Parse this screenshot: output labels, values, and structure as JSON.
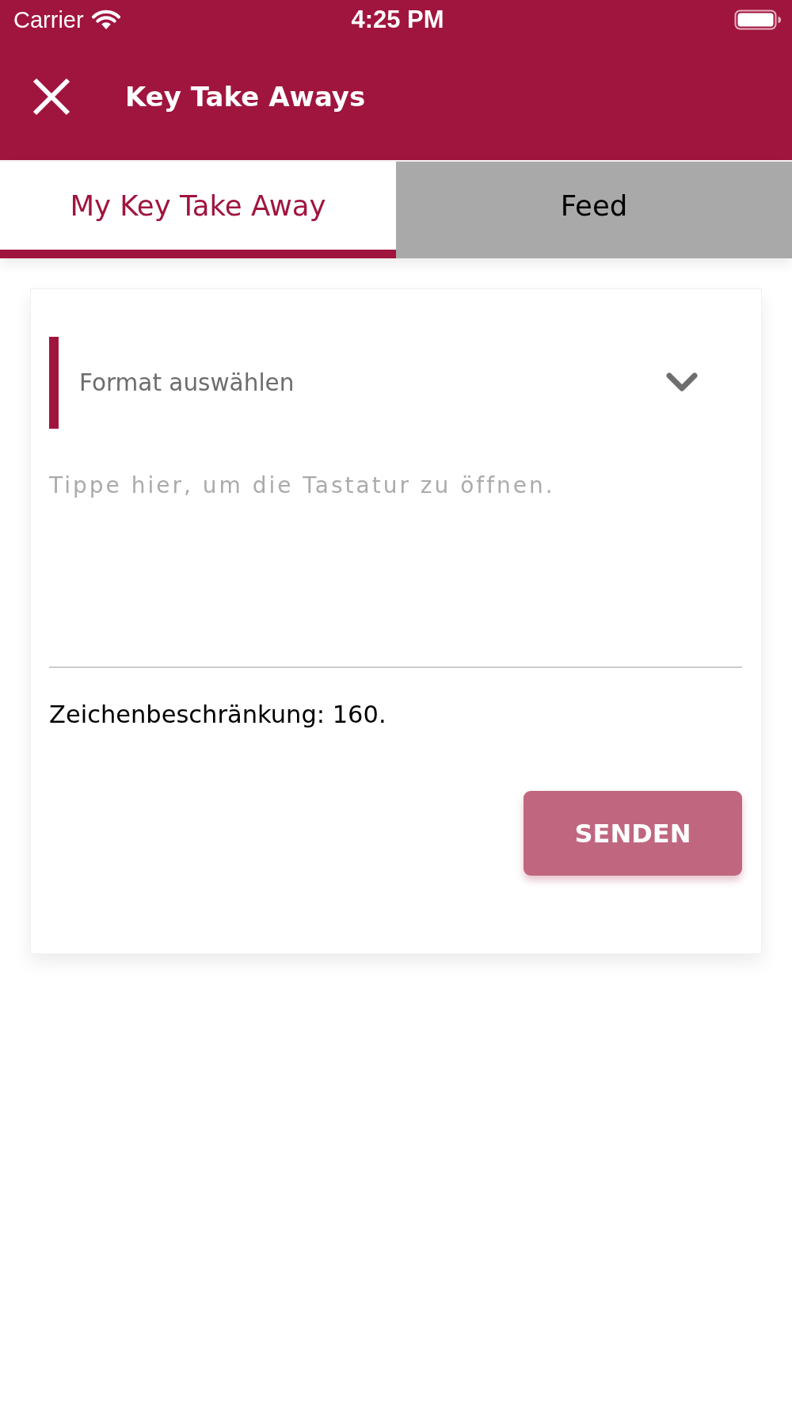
{
  "status_bar": {
    "carrier": "Carrier",
    "time": "4:25 PM"
  },
  "header": {
    "title": "Key Take Aways"
  },
  "tabs": [
    {
      "label": "My Key Take Away",
      "selected": true
    },
    {
      "label": "Feed",
      "selected": false
    }
  ],
  "form": {
    "format_select": {
      "placeholder": "Format auswählen"
    },
    "text_area": {
      "placeholder": "Tippe hier, um die Tastatur zu öffnen."
    },
    "limit_note": "Zeichenbeschränkung: 160.",
    "send_button": {
      "label": "SENDEN",
      "disabled": true
    }
  }
}
